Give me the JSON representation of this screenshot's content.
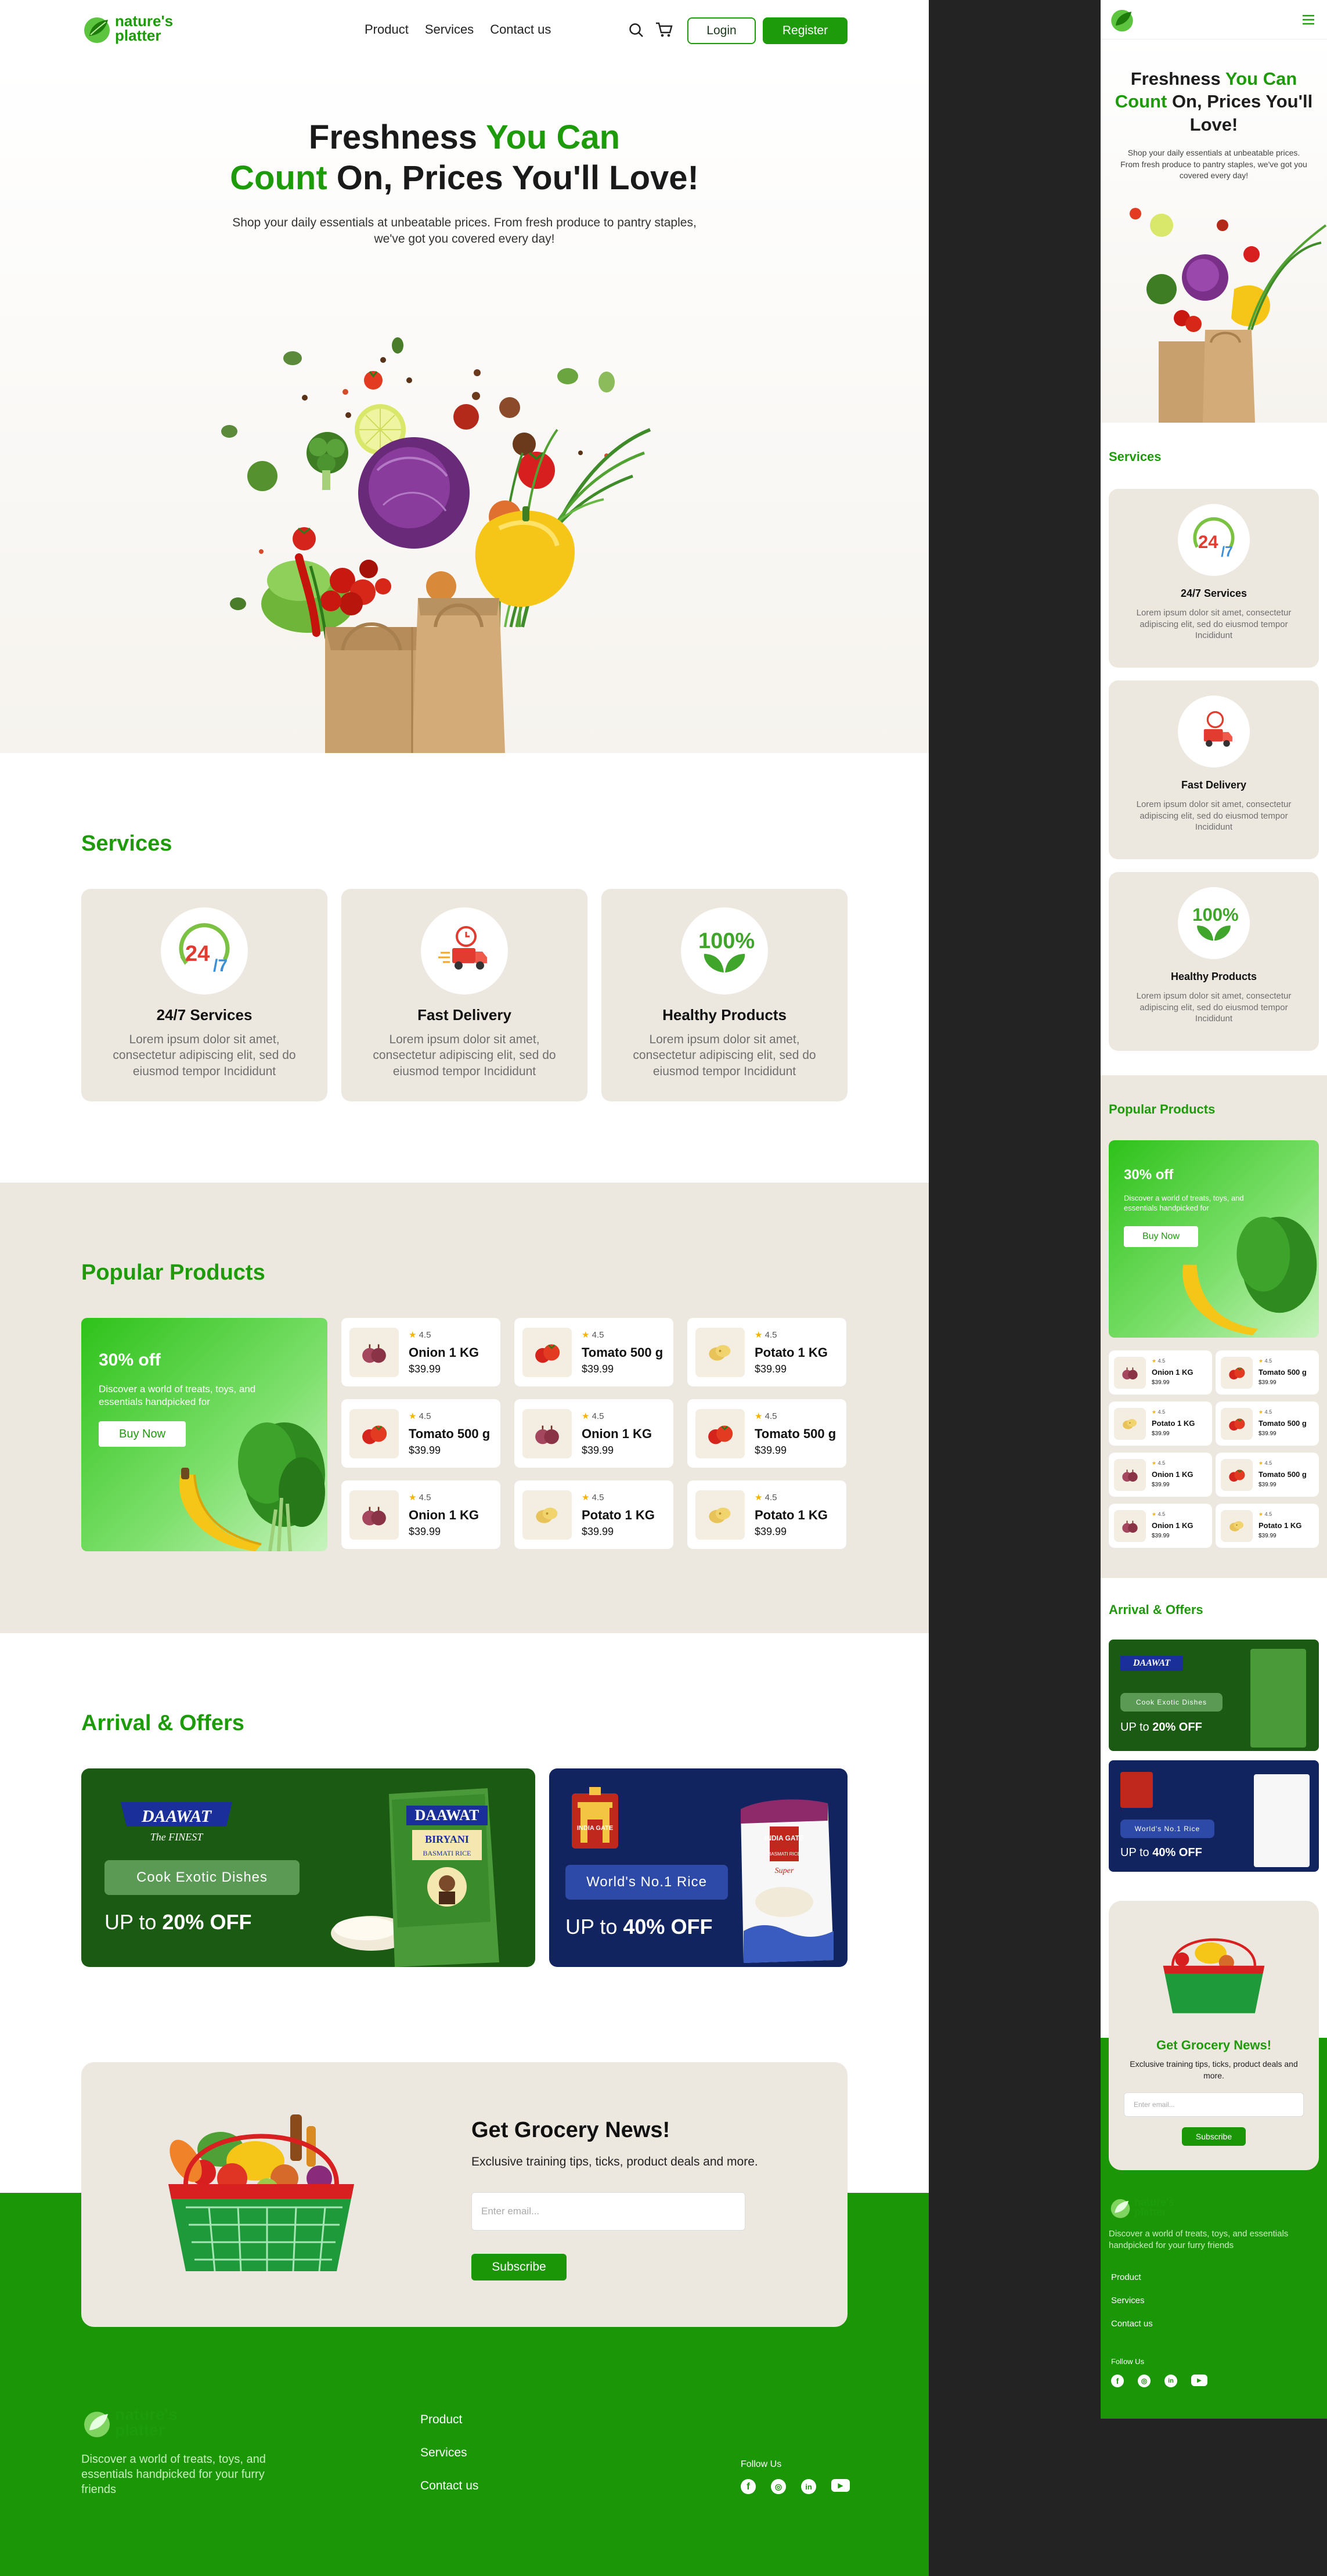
{
  "brand": {
    "line1": "nature's",
    "line2": "platter"
  },
  "nav": {
    "links": [
      "Product",
      "Services",
      "Contact us"
    ],
    "login": "Login",
    "register": "Register"
  },
  "hero": {
    "title_part1": "Freshness ",
    "title_green1": "You Can",
    "title_green2": "Count",
    "title_part2": " On, Prices You'll Love!",
    "subtitle": "Shop your daily essentials at unbeatable prices. From fresh produce to pantry staples, we've got you covered every day!"
  },
  "services": {
    "title": "Services",
    "items": [
      {
        "name": "24/7 Services",
        "desc": "Lorem ipsum dolor sit amet, consectetur adipiscing elit, sed do eiusmod tempor Incididunt",
        "icon": "24-7-icon"
      },
      {
        "name": "Fast Delivery",
        "desc": "Lorem ipsum dolor sit amet, consectetur adipiscing elit, sed do eiusmod tempor Incididunt",
        "icon": "delivery-truck-icon"
      },
      {
        "name": "Healthy Products",
        "desc": "Lorem ipsum dolor sit amet, consectetur adipiscing elit, sed do eiusmod tempor Incididunt",
        "icon": "100-percent-leaf-icon"
      }
    ]
  },
  "popular": {
    "title": "Popular Products",
    "promo": {
      "percent": "30% off",
      "desc": "Discover a world of treats, toys, and essentials handpicked for",
      "button": "Buy Now"
    },
    "products": [
      {
        "name": "Onion 1 KG",
        "price": "$39.99",
        "rating": "4.5",
        "kind": "onion"
      },
      {
        "name": "Tomato 500 g",
        "price": "$39.99",
        "rating": "4.5",
        "kind": "tomato"
      },
      {
        "name": "Potato 1 KG",
        "price": "$39.99",
        "rating": "4.5",
        "kind": "potato"
      },
      {
        "name": "Tomato 500 g",
        "price": "$39.99",
        "rating": "4.5",
        "kind": "tomato"
      },
      {
        "name": "Onion 1 KG",
        "price": "$39.99",
        "rating": "4.5",
        "kind": "onion"
      },
      {
        "name": "Tomato 500 g",
        "price": "$39.99",
        "rating": "4.5",
        "kind": "tomato"
      },
      {
        "name": "Onion 1 KG",
        "price": "$39.99",
        "rating": "4.5",
        "kind": "onion"
      },
      {
        "name": "Potato 1 KG",
        "price": "$39.99",
        "rating": "4.5",
        "kind": "potato"
      },
      {
        "name": "Potato 1 KG",
        "price": "$39.99",
        "rating": "4.5",
        "kind": "potato"
      }
    ],
    "mobile_products": [
      {
        "name": "Onion 1 KG",
        "price": "$39.99",
        "rating": "4.5",
        "kind": "onion"
      },
      {
        "name": "Tomato 500 g",
        "price": "$39.99",
        "rating": "4.5",
        "kind": "tomato"
      },
      {
        "name": "Potato 1 KG",
        "price": "$39.99",
        "rating": "4.5",
        "kind": "potato"
      },
      {
        "name": "Tomato 500 g",
        "price": "$39.99",
        "rating": "4.5",
        "kind": "tomato"
      },
      {
        "name": "Onion 1 KG",
        "price": "$39.99",
        "rating": "4.5",
        "kind": "onion"
      },
      {
        "name": "Tomato 500 g",
        "price": "$39.99",
        "rating": "4.5",
        "kind": "tomato"
      },
      {
        "name": "Onion 1 KG",
        "price": "$39.99",
        "rating": "4.5",
        "kind": "onion"
      },
      {
        "name": "Potato 1 KG",
        "price": "$39.99",
        "rating": "4.5",
        "kind": "potato"
      }
    ]
  },
  "offers": {
    "title": "Arrival & Offers",
    "items": [
      {
        "brand": "DAAWAT",
        "brand_sub": "The FINEST",
        "pack_brand": "DAAWAT",
        "pack_line1": "BIRYANI",
        "pack_line2": "BASMATI RICE",
        "tag": "Cook Exotic Dishes",
        "off_prefix": "UP to ",
        "off_value": "20% OFF",
        "bg": "#1b5a12",
        "tag_bg": "#5a9a55"
      },
      {
        "brand": "INDIA GATE",
        "pack_brand": "INDIA GATE",
        "pack_line1": "BASMATI RICE",
        "pack_line2": "Super",
        "tag": "World's No.1 Rice",
        "off_prefix": "UP to ",
        "off_value": "40% OFF",
        "bg": "#12245f",
        "tag_bg": "#2d4aa8"
      }
    ]
  },
  "newsletter": {
    "title": "Get Grocery News!",
    "subtitle": "Exclusive training tips, ticks, product deals and more.",
    "placeholder": "Enter email...",
    "button": "Subscribe"
  },
  "footer": {
    "desc": "Discover a world of treats, toys, and essentials handpicked for your furry friends",
    "links": [
      "Product",
      "Services",
      "Contact us"
    ],
    "follow": "Follow Us",
    "socials": [
      "facebook-icon",
      "instagram-icon",
      "linkedin-icon",
      "youtube-icon"
    ]
  },
  "colors": {
    "green": "#1e9b0a",
    "beige": "#ede8df",
    "footer_green": "#1a9607"
  }
}
